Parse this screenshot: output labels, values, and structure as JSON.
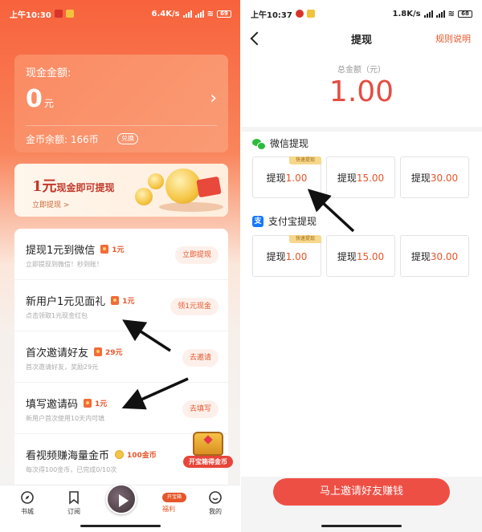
{
  "left": {
    "status": {
      "time": "上午10:30",
      "speed": "6.4K/s",
      "battery": "69"
    },
    "cash_card": {
      "label": "现金金额:",
      "amount": "0",
      "unit": "元",
      "coin_balance": "金币余额: 166币",
      "exchange": "兑换"
    },
    "banner": {
      "big": "1元",
      "rest": "现金即可提现",
      "link": "立即提现 >"
    },
    "tasks": [
      {
        "title": "提现1元到微信",
        "reward": "1元",
        "desc": "立即提现到微信！秒到账！",
        "button": "立即提现"
      },
      {
        "title": "新用户1元见面礼",
        "reward": "1元",
        "desc": "点击领取1元现金红包",
        "button": "领1元现金"
      },
      {
        "title": "首次邀请好友",
        "reward": "29元",
        "desc": "首次邀请好友，奖励29元",
        "button": "去邀请"
      },
      {
        "title": "填写邀请码",
        "reward": "1元",
        "desc": "新用户首次使用10天内可填",
        "button": "去填写"
      },
      {
        "title": "看视频赚海量金币",
        "reward": "100金币",
        "desc": "每次得100金币，已完成0/10次",
        "button": "立"
      }
    ],
    "treasure_label": "开宝箱得金币",
    "tabs": {
      "bookstore": "书城",
      "subscribe": "订阅",
      "welfare": "福利",
      "welfare_badge": "开宝箱",
      "mine": "我的"
    }
  },
  "right": {
    "status": {
      "time": "上午10:37",
      "speed": "1.8K/s",
      "battery": "68"
    },
    "title": "提现",
    "rules": "规则说明",
    "total_label": "总金额（元）",
    "total_amount": "1.00",
    "wechat": {
      "label": "微信提现",
      "options": [
        {
          "prefix": "提现",
          "amount": "1.00",
          "tag": "快速提现"
        },
        {
          "prefix": "提现",
          "amount": "15.00",
          "tag": ""
        },
        {
          "prefix": "提现",
          "amount": "30.00",
          "tag": ""
        }
      ]
    },
    "alipay": {
      "label": "支付宝提现",
      "icon_char": "支",
      "options": [
        {
          "prefix": "提现",
          "amount": "1.00",
          "tag": "快速提现"
        },
        {
          "prefix": "提现",
          "amount": "15.00",
          "tag": ""
        },
        {
          "prefix": "提现",
          "amount": "30.00",
          "tag": ""
        }
      ]
    },
    "invite_button": "马上邀请好友赚钱"
  },
  "colors": {
    "accent": "#e5562a",
    "header_orange": "#f7623c",
    "invite_red": "#ee4f45",
    "wechat_green": "#2dbb3d",
    "alipay_blue": "#1678ff"
  }
}
